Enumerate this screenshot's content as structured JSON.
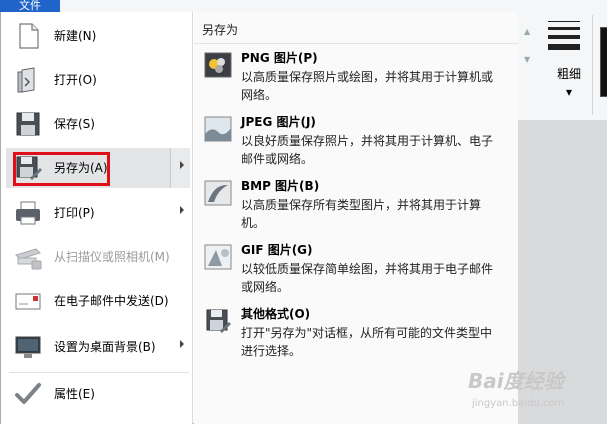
{
  "app": {
    "file_tab": "文件"
  },
  "ribbon": {
    "thickness_label": "粗细",
    "thickness_arrow": "▾"
  },
  "menu": {
    "items": [
      {
        "label": "新建(N)",
        "icon": "new-document-icon"
      },
      {
        "label": "打开(O)",
        "icon": "open-folder-icon"
      },
      {
        "label": "保存(S)",
        "icon": "save-icon"
      },
      {
        "label": "另存为(A)",
        "icon": "save-as-icon",
        "selected": true,
        "submenu": true
      },
      {
        "label": "打印(P)",
        "icon": "printer-icon",
        "submenu": true
      },
      {
        "label": "从扫描仪或照相机(M)",
        "icon": "scanner-icon",
        "disabled": true
      },
      {
        "label": "在电子邮件中发送(D)",
        "icon": "email-icon"
      },
      {
        "label": "设置为桌面背景(B)",
        "icon": "desktop-icon",
        "submenu": true
      },
      {
        "label": "属性(E)",
        "icon": "checkmark-icon"
      }
    ]
  },
  "save_as": {
    "title": "另存为",
    "options": [
      {
        "title": "PNG 图片(P)",
        "desc": "以高质量保存照片或绘图，并将其用于计算机或网络。",
        "icon": "png-image-icon"
      },
      {
        "title": "JPEG 图片(J)",
        "desc": "以良好质量保存照片，并将其用于计算机、电子邮件或网络。",
        "icon": "jpeg-image-icon"
      },
      {
        "title": "BMP 图片(B)",
        "desc": "以高质量保存所有类型图片，并将其用于计算机。",
        "icon": "bmp-image-icon"
      },
      {
        "title": "GIF 图片(G)",
        "desc": "以较低质量保存简单绘图，并将其用于电子邮件或网络。",
        "icon": "gif-image-icon"
      },
      {
        "title": "其他格式(O)",
        "desc": "打开\"另存为\"对话框，从所有可能的文件类型中进行选择。",
        "icon": "other-formats-icon"
      }
    ]
  },
  "watermark": {
    "main": "Bai度经验",
    "sub": "jingyan.baidu.com"
  },
  "colors": {
    "highlight": "#e0101a",
    "file_tab": "#1f64c8",
    "selected_bg": "#e3e4e6"
  }
}
